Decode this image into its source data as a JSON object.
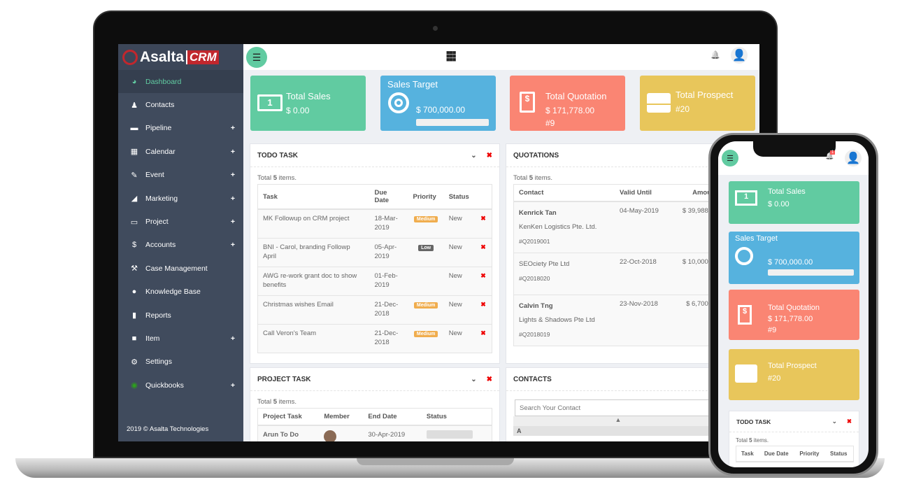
{
  "brand": {
    "name": "Asalta",
    "product": "CRM"
  },
  "sidebar": {
    "items": [
      {
        "label": "Dashboard",
        "icon": "dashboard-icon",
        "glyph": "◕",
        "plus": false
      },
      {
        "label": "Contacts",
        "icon": "person-icon",
        "glyph": "♟",
        "plus": false
      },
      {
        "label": "Pipeline",
        "icon": "briefcase-icon",
        "glyph": "▬",
        "plus": true
      },
      {
        "label": "Calendar",
        "icon": "calendar-icon",
        "glyph": "▦",
        "plus": true
      },
      {
        "label": "Event",
        "icon": "ticket-icon",
        "glyph": "✎",
        "plus": true
      },
      {
        "label": "Marketing",
        "icon": "bullhorn-icon",
        "glyph": "◢",
        "plus": true
      },
      {
        "label": "Project",
        "icon": "presentation-icon",
        "glyph": "▭",
        "plus": true
      },
      {
        "label": "Accounts",
        "icon": "dollar-icon",
        "glyph": "$",
        "plus": true
      },
      {
        "label": "Case Management",
        "icon": "gavel-icon",
        "glyph": "⚒",
        "plus": false
      },
      {
        "label": "Knowledge Base",
        "icon": "comments-icon",
        "glyph": "●",
        "plus": false
      },
      {
        "label": "Reports",
        "icon": "bar-chart-icon",
        "glyph": "▮",
        "plus": false
      },
      {
        "label": "Item",
        "icon": "folder-icon",
        "glyph": "■",
        "plus": true
      },
      {
        "label": "Settings",
        "icon": "cogs-icon",
        "glyph": "⚙",
        "plus": false
      },
      {
        "label": "Quickbooks",
        "icon": "quickbooks-icon",
        "glyph": "◉",
        "plus": true
      }
    ],
    "plus": "+",
    "footer": "2019 © Asalta Technologies"
  },
  "header": {
    "menu_icon": "☰",
    "apps_icon": "⋮⋮⋮",
    "bell_icon": "🔔",
    "notification_count": "1"
  },
  "cards": {
    "total_sales": {
      "title": "Total Sales",
      "value": "$ 0.00",
      "color": "#61cba1"
    },
    "sales_target": {
      "title": "Sales Target",
      "value": "$ 700,000.00",
      "progress": 0,
      "color": "#56b2de"
    },
    "total_quotation": {
      "title": "Total Quotation",
      "value": "$ 171,778.00",
      "count": "#9",
      "color": "#fa8573"
    },
    "total_prospect": {
      "title": "Total Prospect",
      "value": "#20",
      "color": "#e8c65b"
    }
  },
  "todo": {
    "title": "TODO TASK",
    "total_pre": "Total ",
    "total": "5",
    "total_post": " items.",
    "columns": [
      "Task",
      "Due Date",
      "Priority",
      "Status"
    ],
    "rows": [
      {
        "task": "MK Followup on CRM project",
        "due": "18-Mar-2019",
        "priority": "Medium",
        "status": "New"
      },
      {
        "task": "BNI - Carol, branding Followp April",
        "due": "05-Apr-2019",
        "priority": "Low",
        "status": "New"
      },
      {
        "task": "AWG re-work grant doc to show benefits",
        "due": "01-Feb-2019",
        "priority": "",
        "status": "New"
      },
      {
        "task": "Christmas wishes Email",
        "due": "21-Dec-2018",
        "priority": "Medium",
        "status": "New"
      },
      {
        "task": "Call Veron's Team",
        "due": "21-Dec-2018",
        "priority": "Medium",
        "status": "New"
      }
    ],
    "phone_columns": [
      "Task",
      "Due Date",
      "Priority",
      "Status"
    ]
  },
  "quotations": {
    "title": "QUOTATIONS",
    "total": "5",
    "columns": [
      "Contact",
      "Valid Until",
      "Amount"
    ],
    "rows": [
      {
        "contact": "Kenrick Tan",
        "company": "KenKen Logistics Pte. Ltd.",
        "ref": "#Q2019001",
        "valid": "04-May-2019",
        "amount": "$ 39,988.00"
      },
      {
        "contact": "",
        "company": "SEOciety Pte Ltd",
        "ref": "#Q2018020",
        "valid": "22-Oct-2018",
        "amount": "$ 10,000.00"
      },
      {
        "contact": "Calvin Tng",
        "company": "Lights & Shadows Pte Ltd",
        "ref": "#Q2018019",
        "valid": "23-Nov-2018",
        "amount": "$ 6,700.00"
      }
    ]
  },
  "project_task": {
    "title": "PROJECT TASK",
    "total": "5",
    "columns": [
      "Project Task",
      "Member",
      "End Date",
      "Status"
    ],
    "rows": [
      {
        "task": "Arun To Do",
        "end": "30-Apr-2019"
      }
    ]
  },
  "contacts": {
    "title": "CONTACTS",
    "search_placeholder": "Search Your Contact",
    "letter": "A"
  }
}
